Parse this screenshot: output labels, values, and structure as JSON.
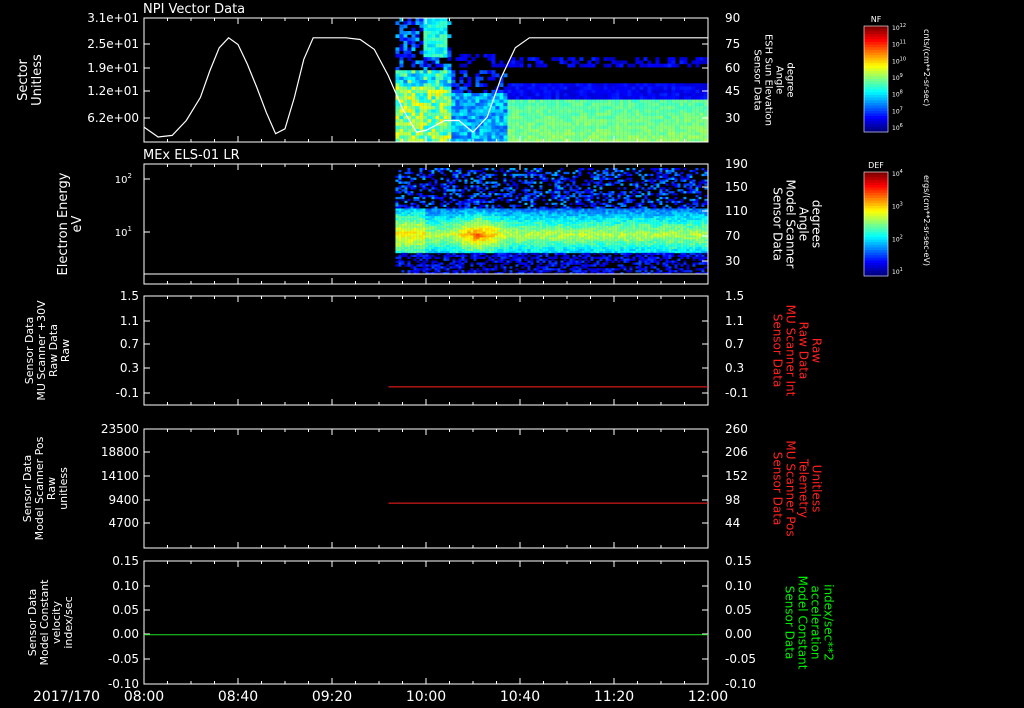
{
  "colors": {
    "background": "#000000",
    "foreground": "#ffffff",
    "red_trace": "#ff2020",
    "green_trace": "#22dd22",
    "red_label": "#ff2020",
    "green_label": "#00ee00"
  },
  "time_axis": {
    "start": "2017-06-19T08:00",
    "end": "2017-06-19T12:00",
    "date_label": "2017/170",
    "ticks": [
      "08:00",
      "08:40",
      "09:20",
      "10:00",
      "10:40",
      "11:20",
      "12:00"
    ]
  },
  "colorbars": [
    {
      "tag": "NF",
      "unit_label": "cnts/(cm**2-sr-sec)",
      "ticks": [
        "10^12",
        "10^11",
        "10^10",
        "10^9",
        "10^8",
        "10^7",
        "10^6"
      ]
    },
    {
      "tag": "DEF",
      "unit_label": "ergs/(cm**2-sr-sec-eV)",
      "ticks": [
        "10^4",
        "10^3",
        "10^2",
        "10^1"
      ]
    }
  ],
  "chart_data": [
    {
      "type": "heatmap",
      "title": "NPI Vector Data",
      "ylabel": [
        "Sector",
        "Unitless"
      ],
      "yticks_left": [
        "3.1e+01",
        "2.5e+01",
        "1.9e+01",
        "1.2e+01",
        "6.2e+00"
      ],
      "yticks_right": [
        "90",
        "75",
        "60",
        "45",
        "30"
      ],
      "ylim_right": [
        15,
        90
      ],
      "ylabel_right": [
        "Sensor Data",
        "ESH Sun Elevation",
        "Angle",
        "degree"
      ],
      "colorbar": "NF",
      "data_start": "09:47",
      "line_series": {
        "name": "ESH Sun Elevation Angle",
        "x": [
          "08:00",
          "08:06",
          "08:12",
          "08:18",
          "08:24",
          "08:28",
          "08:32",
          "08:36",
          "08:40",
          "08:44",
          "08:48",
          "08:52",
          "08:56",
          "09:00",
          "09:04",
          "09:08",
          "09:12",
          "09:16",
          "09:20",
          "09:26",
          "09:32",
          "09:38",
          "09:44",
          "09:50",
          "09:56",
          "10:00",
          "10:04",
          "10:08",
          "10:14",
          "10:20",
          "10:26",
          "10:32",
          "10:38",
          "10:44",
          "10:50",
          "11:00",
          "11:20",
          "11:40",
          "12:00"
        ],
        "y": [
          24,
          18,
          19,
          28,
          42,
          58,
          72,
          78,
          74,
          62,
          48,
          33,
          20,
          23,
          42,
          65,
          78,
          78,
          78,
          78,
          77,
          71,
          55,
          35,
          21,
          22,
          25,
          28,
          28,
          21,
          30,
          54,
          72,
          78,
          78,
          78,
          78,
          78,
          78
        ]
      }
    },
    {
      "type": "heatmap",
      "title": "MEx ELS-01 LR",
      "ylabel": [
        "Electron Energy",
        "eV"
      ],
      "yticks_left": [
        "10^2",
        "10^1"
      ],
      "yticks_right": [
        "190",
        "150",
        "110",
        "70",
        "30"
      ],
      "ylim_right": [
        10,
        190
      ],
      "ylabel_right": [
        "Sensor Data",
        "Model Scanner",
        "Angle",
        "degrees"
      ],
      "colorbar": "DEF",
      "data_start": "09:47",
      "line_series": {
        "name": "Model Scanner Angle",
        "x": [
          "08:00",
          "12:00"
        ],
        "y": [
          10,
          10
        ]
      }
    },
    {
      "type": "line",
      "ylabel": [
        "Sensor Data",
        "MU Scanner +30V",
        "Raw Data",
        "Raw"
      ],
      "ylim": [
        -0.3,
        1.5
      ],
      "yticks": [
        "1.5",
        "1.1",
        "0.7",
        "0.3",
        "-0.1"
      ],
      "yticks_right": [
        "1.5",
        "1.1",
        "0.7",
        "0.3",
        "-0.1"
      ],
      "ylabel_right": [
        "Sensor Data",
        "MU Scanner Int",
        "Raw Data",
        "Raw"
      ],
      "series": [
        {
          "x": [
            "09:44",
            "12:00"
          ],
          "y": [
            0.0,
            0.0
          ],
          "color": "red"
        }
      ]
    },
    {
      "type": "line",
      "ylabel": [
        "Sensor Data",
        "Model Scanner Pos",
        "Raw",
        "unitless"
      ],
      "ylim": [
        0,
        23500
      ],
      "yticks": [
        "23500",
        "18800",
        "14100",
        "9400",
        "4700"
      ],
      "yticks_right": [
        "260",
        "206",
        "152",
        "98",
        "44"
      ],
      "ylim_right": [
        0,
        260
      ],
      "ylabel_right": [
        "Sensor Data",
        "MU Scanner Pos",
        "Telemetry",
        "Unitless"
      ],
      "series": [
        {
          "x": [
            "09:44",
            "12:00"
          ],
          "y": [
            98,
            98
          ],
          "axis": "right",
          "color": "red"
        }
      ]
    },
    {
      "type": "line",
      "ylabel": [
        "Sensor Data",
        "Model Constant",
        "velocity",
        "index/sec"
      ],
      "ylim": [
        -0.1,
        0.15
      ],
      "yticks": [
        "0.15",
        "0.10",
        "0.05",
        "0.00",
        "-0.05",
        "-0.10"
      ],
      "yticks_right": [
        "0.15",
        "0.10",
        "0.05",
        "0.00",
        "-0.05",
        "-0.10"
      ],
      "ylabel_right": [
        "Sensor Data",
        "Model Constant",
        "acceleration",
        "index/sec**2"
      ],
      "series": [
        {
          "x": [
            "08:00",
            "12:00"
          ],
          "y": [
            0.0,
            0.0
          ],
          "color": "green"
        }
      ]
    }
  ]
}
